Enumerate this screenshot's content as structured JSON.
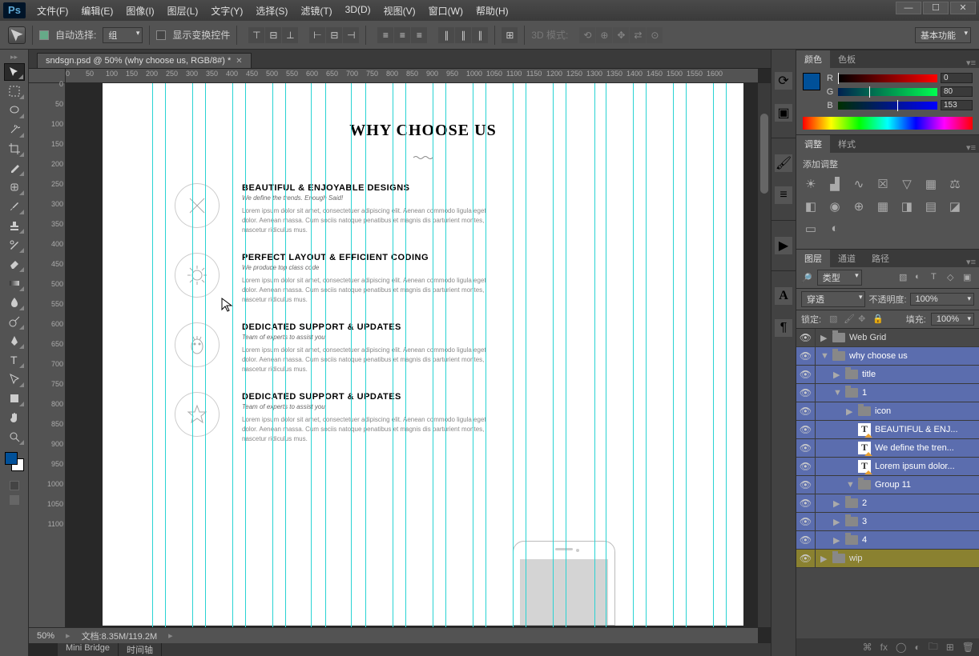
{
  "app": {
    "logo": "Ps"
  },
  "menu": [
    "文件(F)",
    "编辑(E)",
    "图像(I)",
    "图层(L)",
    "文字(Y)",
    "选择(S)",
    "滤镜(T)",
    "3D(D)",
    "视图(V)",
    "窗口(W)",
    "帮助(H)"
  ],
  "window_controls": [
    "—",
    "☐",
    "✕"
  ],
  "options": {
    "auto_select": "自动选择:",
    "auto_select_mode": "组",
    "transform_controls": "显示变换控件",
    "mode3d_label": "3D 模式:",
    "preset": "基本功能"
  },
  "tab": {
    "title": "sndsgn.psd @ 50% (why choose us, RGB/8#) *"
  },
  "ruler_h": [
    "0",
    "50",
    "100",
    "150",
    "200",
    "250",
    "300",
    "350",
    "400",
    "450",
    "500",
    "550",
    "600",
    "650",
    "700",
    "750",
    "800",
    "850",
    "900",
    "950",
    "1000",
    "1050",
    "1100",
    "1150",
    "1200",
    "1250",
    "1300",
    "1350",
    "1400",
    "1450",
    "1500",
    "1550",
    "1600"
  ],
  "ruler_v": [
    "0",
    "50",
    "100",
    "150",
    "200",
    "250",
    "300",
    "350",
    "400",
    "450",
    "500",
    "550",
    "600",
    "650",
    "700",
    "750",
    "800",
    "850",
    "900",
    "950",
    "1000",
    "1050",
    "1100"
  ],
  "status": {
    "zoom": "50%",
    "doc_label": "文档:",
    "doc_info": "8.35M/119.2M"
  },
  "bottom_tabs": [
    "Mini Bridge",
    "时间轴"
  ],
  "design": {
    "title": "WHY CHOOSE US",
    "features": [
      {
        "h": "BEAUTIFUL & ENJOYABLE DESIGNS",
        "sub": "We define the trends. Enough Said!",
        "body": "Lorem ipsum dolor sit amet, consectetuer adipiscing elit. Aenean commodo ligula eget dolor. Aenean massa. Cum sociis natoque penatibus et magnis dis parturient montes, nascetur ridiculus mus."
      },
      {
        "h": "PERFECT LAYOUT & EFFICIENT CODING",
        "sub": "We produce top class code",
        "body": "Lorem ipsum dolor sit amet, consectetuer adipiscing elit. Aenean commodo ligula eget dolor. Aenean massa. Cum sociis natoque penatibus et magnis dis parturient montes, nascetur ridiculus mus."
      },
      {
        "h": "DEDICATED SUPPORT & UPDATES",
        "sub": "Team of experts to assist you.",
        "body": "Lorem ipsum dolor sit amet, consectetuer adipiscing elit. Aenean commodo ligula eget dolor. Aenean massa. Cum sociis natoque penatibus et magnis dis parturient montes, nascetur ridiculus mus."
      },
      {
        "h": "DEDICATED SUPPORT & UPDATES",
        "sub": "Team of experts to assist you.",
        "body": "Lorem ipsum dolor sit amet, consectetuer adipiscing elit. Aenean commodo ligula eget dolor. Aenean massa. Cum sociis natoque penatibus et magnis dis parturient montes, nascetur ridiculus mus."
      }
    ]
  },
  "color_panel": {
    "tabs": [
      "颜色",
      "色板"
    ],
    "channels": [
      {
        "label": "R",
        "value": "0"
      },
      {
        "label": "G",
        "value": "80"
      },
      {
        "label": "B",
        "value": "153"
      }
    ]
  },
  "adjust_panel": {
    "tabs": [
      "调整",
      "样式"
    ],
    "add_label": "添加调整"
  },
  "layers_panel": {
    "tabs": [
      "图层",
      "通道",
      "路径"
    ],
    "filter_label": "类型",
    "blend_mode": "穿透",
    "opacity_label": "不透明度:",
    "opacity": "100%",
    "lock_label": "锁定:",
    "fill_label": "填充:",
    "fill": "100%",
    "layers": [
      {
        "depth": 0,
        "twisty": "▶",
        "kind": "folder",
        "name": "Web Grid",
        "sel": false
      },
      {
        "depth": 0,
        "twisty": "▼",
        "kind": "folder",
        "name": "why choose us",
        "sel": true
      },
      {
        "depth": 1,
        "twisty": "▶",
        "kind": "folder",
        "name": "title",
        "sel": true
      },
      {
        "depth": 1,
        "twisty": "▼",
        "kind": "folder",
        "name": "1",
        "sel": true
      },
      {
        "depth": 2,
        "twisty": "▶",
        "kind": "folder",
        "name": "icon",
        "sel": true
      },
      {
        "depth": 2,
        "twisty": "",
        "kind": "text",
        "name": "BEAUTIFUL & ENJ...",
        "sel": true
      },
      {
        "depth": 2,
        "twisty": "",
        "kind": "text",
        "name": "We define the tren...",
        "sel": true
      },
      {
        "depth": 2,
        "twisty": "",
        "kind": "text",
        "name": "Lorem ipsum dolor...",
        "sel": true
      },
      {
        "depth": 2,
        "twisty": "▼",
        "kind": "folder",
        "name": "Group 11",
        "sel": true
      },
      {
        "depth": 1,
        "twisty": "▶",
        "kind": "folder",
        "name": "2",
        "sel": true
      },
      {
        "depth": 1,
        "twisty": "▶",
        "kind": "folder",
        "name": "3",
        "sel": true
      },
      {
        "depth": 1,
        "twisty": "▶",
        "kind": "folder",
        "name": "4",
        "sel": true
      },
      {
        "depth": 0,
        "twisty": "▶",
        "kind": "folder",
        "name": "wip",
        "sel": false,
        "wip": true
      }
    ]
  }
}
